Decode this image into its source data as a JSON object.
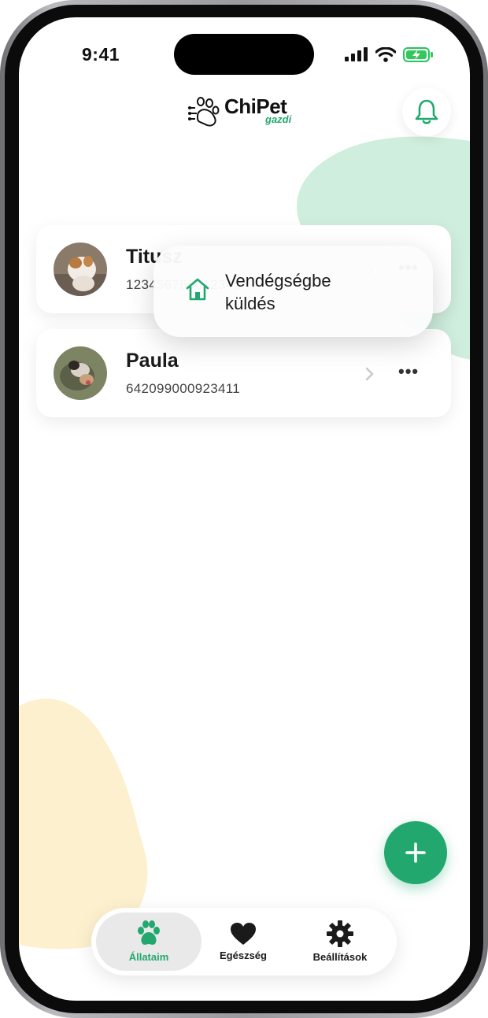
{
  "status_bar": {
    "time": "9:41"
  },
  "header": {
    "logo_title": "ChiPet",
    "logo_subtitle": "gazdi"
  },
  "pets": [
    {
      "name": "Titusz",
      "chip": "123456789012345"
    },
    {
      "name": "Paula",
      "chip": "642099000923411"
    }
  ],
  "context_menu": {
    "item_label": "Vendégségbe küldés"
  },
  "nav": {
    "items": [
      {
        "label": "Állataim",
        "active": true
      },
      {
        "label": "Egészség",
        "active": false
      },
      {
        "label": "Beállítások",
        "active": false
      }
    ]
  },
  "colors": {
    "accent": "#22a86f",
    "blob_green": "#cfeedd",
    "blob_yellow": "#fdf0cf"
  },
  "icons": [
    "bell-icon",
    "home-icon",
    "chevron-right-icon",
    "more-icon",
    "plus-icon",
    "paw-icon",
    "heart-icon",
    "gear-icon"
  ]
}
